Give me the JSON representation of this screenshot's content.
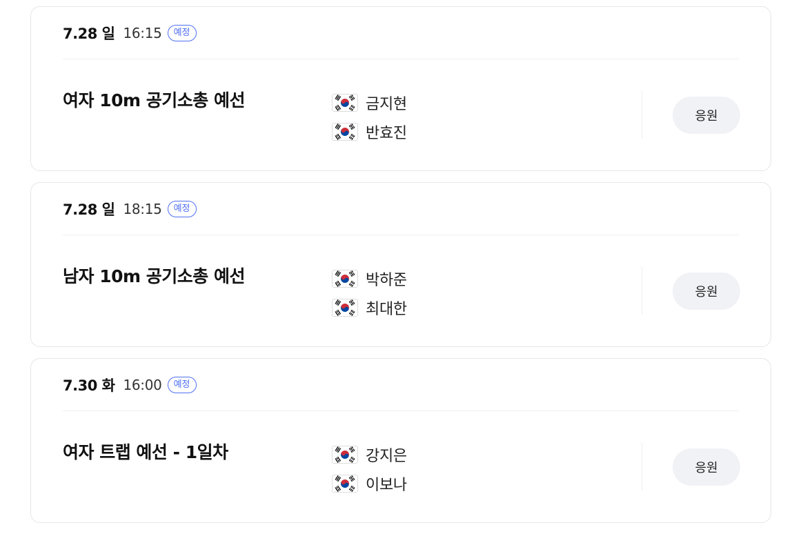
{
  "schedule": [
    {
      "date": "7.28 일",
      "time": "16:15",
      "status": "예정",
      "event": "여자 10m 공기소총 예선",
      "athletes": [
        {
          "flag": "korea-flag-icon",
          "name": "금지현"
        },
        {
          "flag": "korea-flag-icon",
          "name": "반효진"
        }
      ],
      "cheer_label": "응원"
    },
    {
      "date": "7.28 일",
      "time": "18:15",
      "status": "예정",
      "event": "남자 10m 공기소총 예선",
      "athletes": [
        {
          "flag": "korea-flag-icon",
          "name": "박하준"
        },
        {
          "flag": "korea-flag-icon",
          "name": "최대한"
        }
      ],
      "cheer_label": "응원"
    },
    {
      "date": "7.30 화",
      "time": "16:00",
      "status": "예정",
      "event": "여자 트랩 예선 - 1일차",
      "athletes": [
        {
          "flag": "korea-flag-icon",
          "name": "강지은"
        },
        {
          "flag": "korea-flag-icon",
          "name": "이보나"
        }
      ],
      "cheer_label": "응원"
    }
  ],
  "colors": {
    "badge": "#4e6ef2",
    "card_border": "#e4e6ea",
    "cheer_button_bg": "#f1f2f6",
    "flag_red": "#cd2e3a",
    "flag_blue": "#0047a0"
  }
}
